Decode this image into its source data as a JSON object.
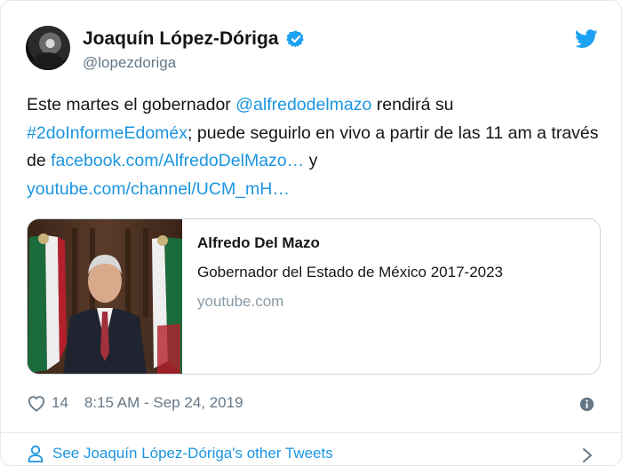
{
  "author": {
    "name": "Joaquín López-Dóriga",
    "handle": "@lopezdoriga"
  },
  "tweet": {
    "t1": "Este martes el gobernador ",
    "mention": "@alfredodelmazo",
    "t2": " rendirá su",
    "hashtag": "#2doInformeEdoméx",
    "t3": "; puede seguirlo en vivo a partir de las 11 am a través de ",
    "link1": "facebook.com/AlfredoDelMazo…",
    "t4": " y",
    "link2": "youtube.com/channel/UCM_mH…"
  },
  "card": {
    "title": "Alfredo Del Mazo",
    "description": "Gobernador del Estado de México 2017-2023",
    "domain": "youtube.com"
  },
  "footer": {
    "likes": "14",
    "timestamp": "8:15 AM - Sep 24, 2019"
  },
  "more_tweets": "See Joaquín López-Dóriga's other Tweets",
  "colors": {
    "link": "#1b95e0",
    "twitter_blue": "#1da1f2",
    "muted": "#657786"
  }
}
